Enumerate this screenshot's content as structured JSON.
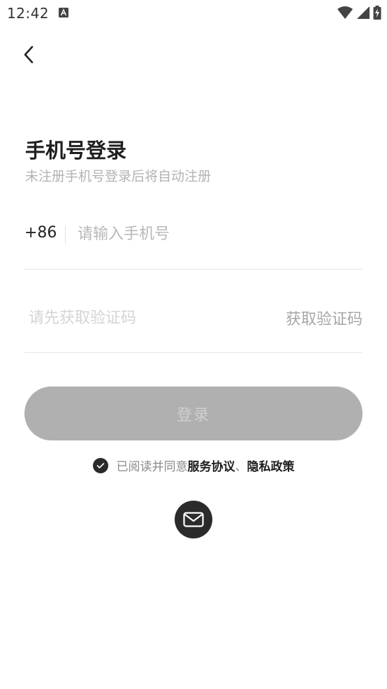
{
  "status_bar": {
    "time": "12:42"
  },
  "header": {
    "title": "手机号登录",
    "subtitle": "未注册手机号登录后将自动注册"
  },
  "phone": {
    "country_code": "+86",
    "placeholder": "请输入手机号"
  },
  "verification": {
    "placeholder": "请先获取验证码",
    "get_code_label": "获取验证码"
  },
  "login_button": {
    "label": "登录"
  },
  "agreement": {
    "prefix": "已阅读并同意 ",
    "service_link": "服务协议",
    "separator": "、",
    "privacy_link": "隐私政策",
    "checked": true
  },
  "alt_login": {
    "icon": "mail-icon"
  },
  "colors": {
    "login_button_bg": "#b0b0b0",
    "checkbox_bg": "#2a2a2a",
    "email_button_bg": "#2b2b2b"
  }
}
